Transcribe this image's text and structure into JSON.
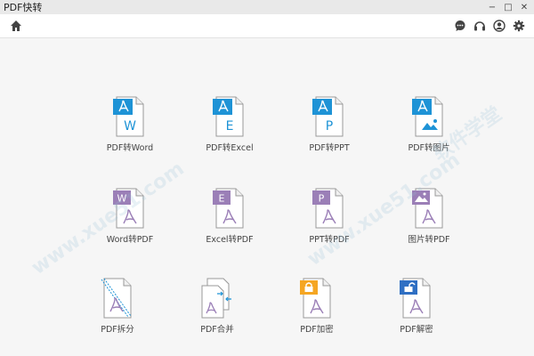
{
  "window": {
    "title": "PDF快转",
    "controls": {
      "minimize": "−",
      "maximize": "□",
      "close": "✕"
    }
  },
  "toolbar": {
    "home_icon": "home-icon",
    "right_icons": [
      "chat-icon",
      "headset-icon",
      "user-icon",
      "gear-icon"
    ]
  },
  "watermark": {
    "text": "www.xue51.com",
    "text2": "软件学堂"
  },
  "tiles": [
    {
      "label": "PDF转Word",
      "icon": "pdf-to-word-icon",
      "badge": "W"
    },
    {
      "label": "PDF转Excel",
      "icon": "pdf-to-excel-icon",
      "badge": "E"
    },
    {
      "label": "PDF转PPT",
      "icon": "pdf-to-ppt-icon",
      "badge": "P"
    },
    {
      "label": "PDF转图片",
      "icon": "pdf-to-image-icon",
      "badge": ""
    },
    {
      "label": "Word转PDF",
      "icon": "word-to-pdf-icon",
      "badge": "W"
    },
    {
      "label": "Excel转PDF",
      "icon": "excel-to-pdf-icon",
      "badge": "E"
    },
    {
      "label": "PPT转PDF",
      "icon": "ppt-to-pdf-icon",
      "badge": "P"
    },
    {
      "label": "图片转PDF",
      "icon": "image-to-pdf-icon",
      "badge": ""
    },
    {
      "label": "PDF拆分",
      "icon": "pdf-split-icon",
      "badge": ""
    },
    {
      "label": "PDF合并",
      "icon": "pdf-merge-icon",
      "badge": ""
    },
    {
      "label": "PDF加密",
      "icon": "pdf-encrypt-icon",
      "badge": ""
    },
    {
      "label": "PDF解密",
      "icon": "pdf-decrypt-icon",
      "badge": ""
    }
  ],
  "colors": {
    "blue": "#1e93d6",
    "purple": "#9b7fb7",
    "orange": "#f5a623",
    "darkblue": "#2f6fc3",
    "gray": "#888888"
  }
}
